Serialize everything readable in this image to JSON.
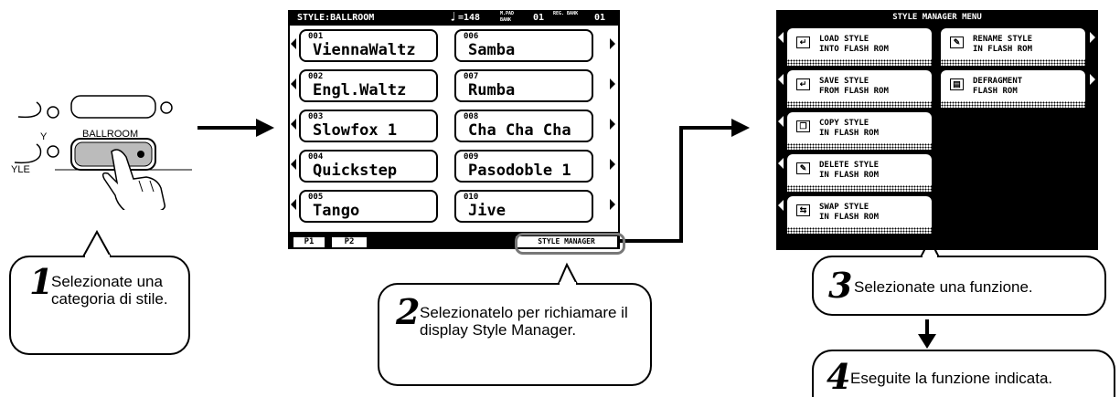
{
  "panel": {
    "partial_label_left": "Y",
    "partial_label_bottom": "YLE",
    "ballroom_label": "BALLROOM"
  },
  "style_screen": {
    "header_title": "STYLE:BALLROOM",
    "tempo": "=148",
    "multipad_bank_label": "M.PAD BANK",
    "multipad_bank_value": "01",
    "reg_bank_label": "REG. BANK",
    "reg_bank_value": "01",
    "styles_left": [
      {
        "num": "001",
        "name": "ViennaWaltz"
      },
      {
        "num": "002",
        "name": "Engl.Waltz"
      },
      {
        "num": "003",
        "name": "Slowfox 1"
      },
      {
        "num": "004",
        "name": "Quickstep"
      },
      {
        "num": "005",
        "name": "Tango"
      }
    ],
    "styles_right": [
      {
        "num": "006",
        "name": "Samba"
      },
      {
        "num": "007",
        "name": "Rumba"
      },
      {
        "num": "008",
        "name": "Cha Cha Cha"
      },
      {
        "num": "009",
        "name": "Pasodoble 1"
      },
      {
        "num": "010",
        "name": "Jive"
      }
    ],
    "tab_p1": "P1",
    "tab_p2": "P2",
    "style_manager_button": "STYLE MANAGER"
  },
  "manager_screen": {
    "title": "STYLE MANAGER MENU",
    "items_left": [
      {
        "line1": "LOAD STYLE",
        "line2": "INTO FLASH ROM",
        "icon": "load-icon"
      },
      {
        "line1": "SAVE STYLE",
        "line2": "FROM FLASH ROM",
        "icon": "save-icon"
      },
      {
        "line1": "COPY STYLE",
        "line2": "IN FLASH ROM",
        "icon": "copy-icon"
      },
      {
        "line1": "DELETE STYLE",
        "line2": "IN FLASH ROM",
        "icon": "delete-icon"
      },
      {
        "line1": "SWAP STYLE",
        "line2": "IN FLASH ROM",
        "icon": "swap-icon"
      }
    ],
    "items_right": [
      {
        "line1": "RENAME STYLE",
        "line2": "IN FLASH ROM",
        "icon": "rename-icon"
      },
      {
        "line1": "DEFRAGMENT",
        "line2": "FLASH ROM",
        "icon": "defragment-icon"
      }
    ]
  },
  "callouts": {
    "step1": {
      "num": "1",
      "text": "Selezionate una categoria di stile."
    },
    "step2": {
      "num": "2",
      "text": "Selezionatelo per richiamare il display Style Manager."
    },
    "step3": {
      "num": "3",
      "text": "Selezionate una funzione."
    },
    "step4": {
      "num": "4",
      "text": "Eseguite la funzione indicata."
    }
  }
}
